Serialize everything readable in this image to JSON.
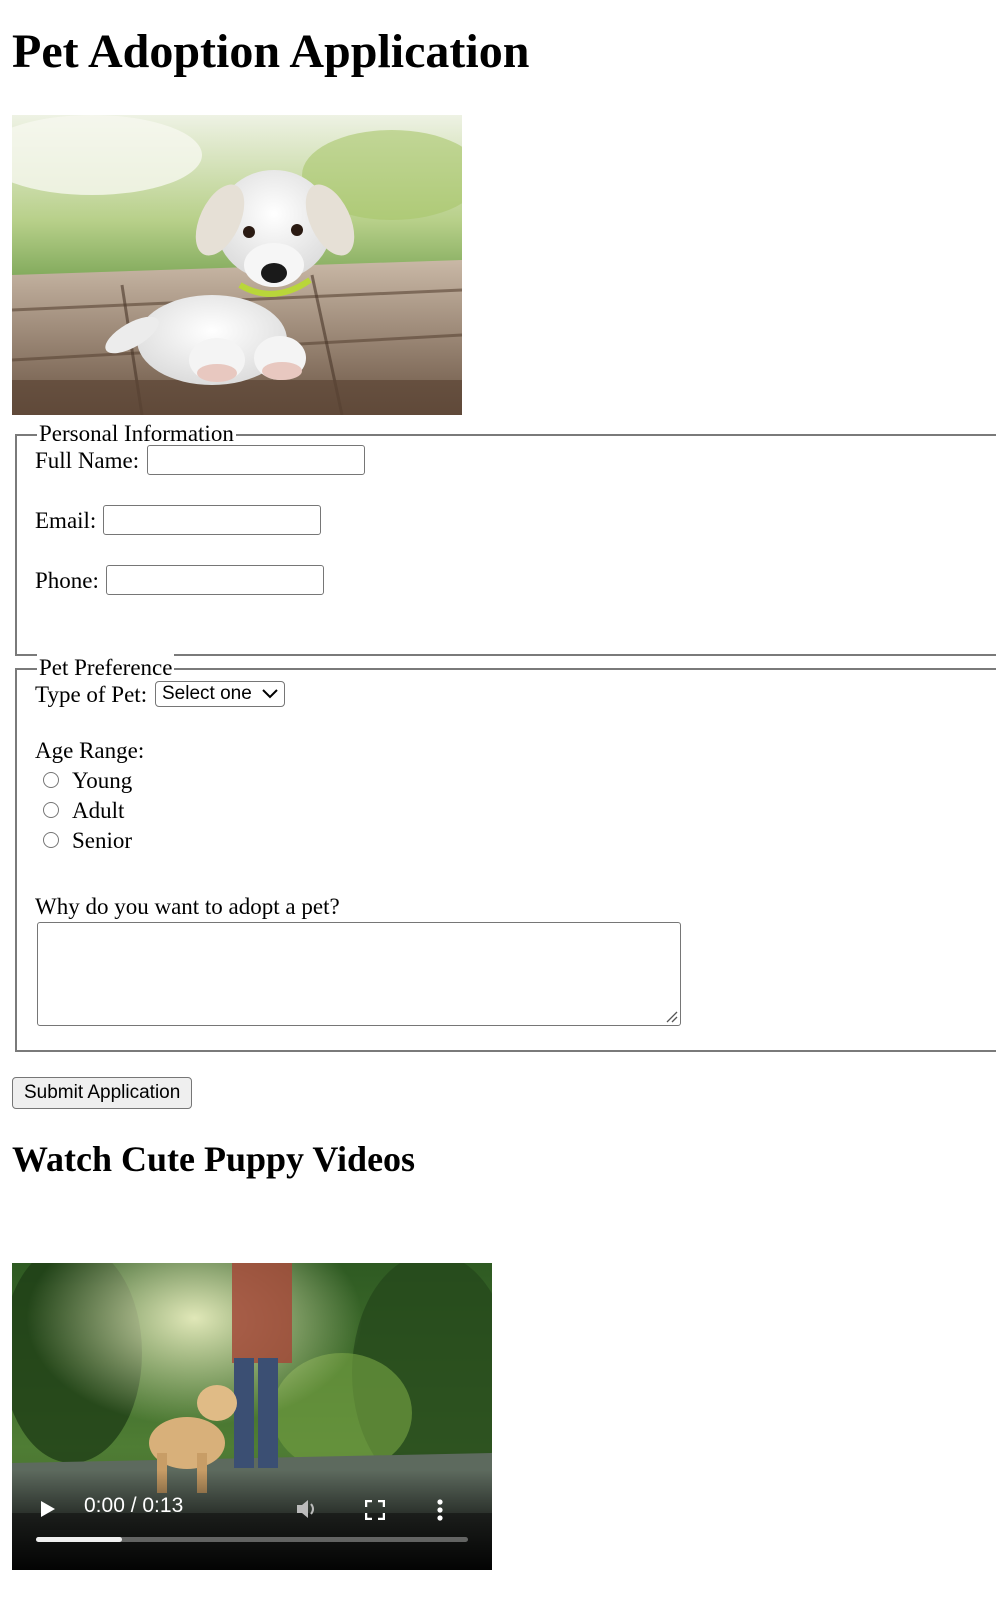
{
  "page": {
    "title": "Pet Adoption Application"
  },
  "hero_image": {
    "subject": "white puppy lying on wooden deck"
  },
  "personal_info": {
    "legend": "Personal Information",
    "fields": [
      {
        "label": "Full Name:",
        "value": "",
        "placeholder": ""
      },
      {
        "label": "Email:",
        "value": "",
        "placeholder": ""
      },
      {
        "label": "Phone:",
        "value": "",
        "placeholder": ""
      }
    ]
  },
  "pet_preference": {
    "legend": "Pet Preference",
    "type_label": "Type of Pet:",
    "type_selected": "Select one",
    "age_label": "Age Range:",
    "age_options": [
      "Young",
      "Adult",
      "Senior"
    ],
    "reason_label": "Why do you want to adopt a pet?",
    "reason_value": ""
  },
  "submit_label": "Submit Application",
  "videos": {
    "heading": "Watch Cute Puppy Videos",
    "player": {
      "time": "0:00 / 0:13",
      "buffered_fraction": 0.2
    }
  },
  "icons": {
    "play": "play-icon",
    "volume": "volume-icon",
    "fullscreen": "fullscreen-icon",
    "more": "more-options-icon",
    "dropdown": "chevron-down-icon"
  }
}
